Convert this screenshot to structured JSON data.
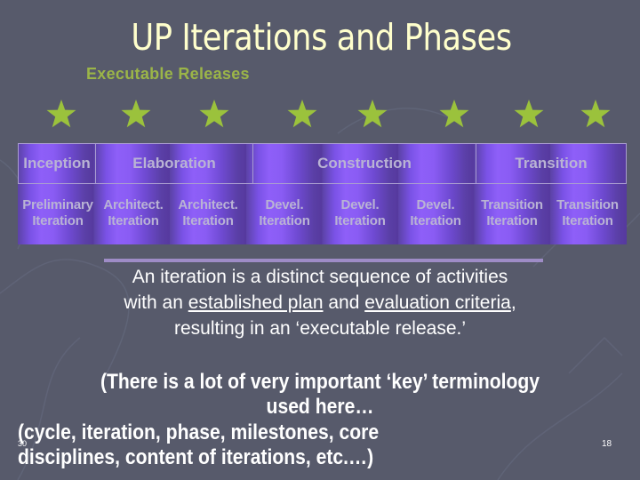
{
  "slide": {
    "title": "UP Iterations and Phases",
    "subtitle": "Executable Releases",
    "release_icon": "star-icon",
    "release_count": 8,
    "colors": {
      "background": "#575a6b",
      "title": "#ffffcc",
      "accent_green": "#9bb548",
      "star": "#9bc23c",
      "phase_purple": "#8a5cf4",
      "phase_text": "#b9b3d4"
    },
    "phases": [
      {
        "label": "Inception"
      },
      {
        "label": "Elaboration"
      },
      {
        "label": "Construction"
      },
      {
        "label": "Transition"
      }
    ],
    "iterations": [
      {
        "line1": "Preliminary",
        "line2": "Iteration"
      },
      {
        "line1": "Architect.",
        "line2": "Iteration"
      },
      {
        "line1": "Architect.",
        "line2": "Iteration"
      },
      {
        "line1": "Devel.",
        "line2": "Iteration"
      },
      {
        "line1": "Devel.",
        "line2": "Iteration"
      },
      {
        "line1": "Devel.",
        "line2": "Iteration"
      },
      {
        "line1": "Transition",
        "line2": "Iteration"
      },
      {
        "line1": "Transition",
        "line2": "Iteration"
      }
    ],
    "definition": {
      "part1": "An iteration is a distinct sequence of activities",
      "part2a": "with an ",
      "part2b": "established plan",
      "part2c": " and ",
      "part2d": "evaluation criteria",
      "part2e": ",",
      "part3": "resulting in an ‘executable release.’"
    },
    "note": {
      "line1": "(There is a lot of very important ‘key’ terminology",
      "line2": "used here…",
      "line3": "(cycle, iteration, phase, milestones, core",
      "line4": "disciplines, content of iterations, etc.…)"
    },
    "footer": {
      "left_number": "30",
      "page_number": "18"
    }
  }
}
